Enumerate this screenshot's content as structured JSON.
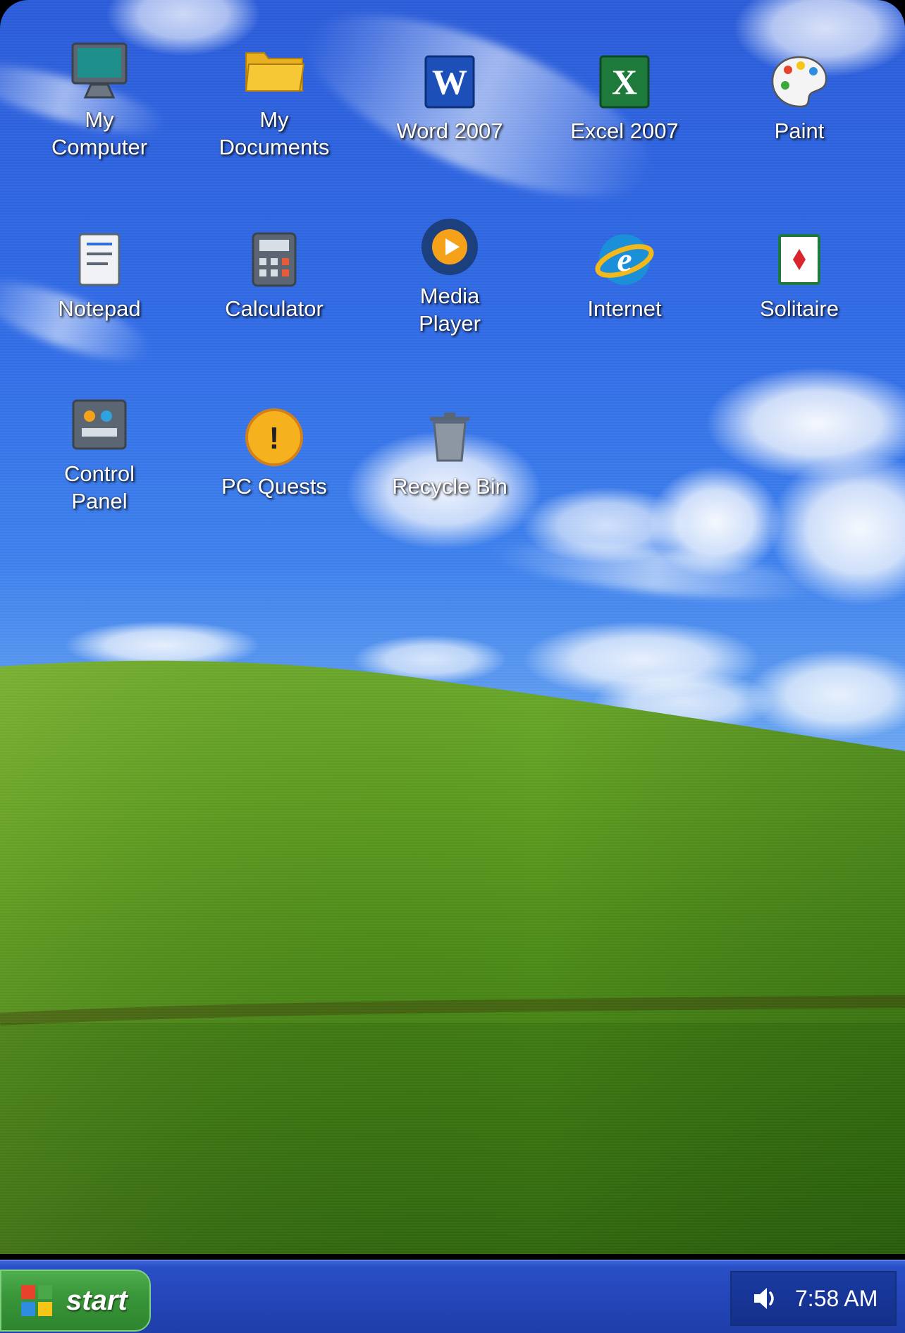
{
  "desktop": {
    "icons": [
      {
        "label": "My\nComputer",
        "icon": "computer-icon"
      },
      {
        "label": "My\nDocuments",
        "icon": "folder-icon"
      },
      {
        "label": "Word 2007",
        "icon": "word-icon"
      },
      {
        "label": "Excel 2007",
        "icon": "excel-icon"
      },
      {
        "label": "Paint",
        "icon": "palette-icon"
      },
      {
        "label": "Notepad",
        "icon": "notepad-icon"
      },
      {
        "label": "Calculator",
        "icon": "calculator-icon"
      },
      {
        "label": "Media\nPlayer",
        "icon": "media-player-icon"
      },
      {
        "label": "Internet",
        "icon": "internet-explorer-icon"
      },
      {
        "label": "Solitaire",
        "icon": "solitaire-card-icon"
      },
      {
        "label": "Control\nPanel",
        "icon": "control-panel-icon"
      },
      {
        "label": "PC Quests",
        "icon": "warning-icon"
      },
      {
        "label": "Recycle Bin",
        "icon": "trash-icon"
      }
    ],
    "word_letter": "W",
    "excel_letter": "X",
    "ie_letter": "e",
    "quest_mark": "!"
  },
  "taskbar": {
    "start_label": "start",
    "clock": "7:58 AM",
    "tray_icon": "volume-icon"
  },
  "colors": {
    "start_green": "#3a973a",
    "taskbar_blue": "#2446b9",
    "logo_red": "#e8412c",
    "logo_green": "#4aa84a",
    "logo_blue": "#2f8de0",
    "logo_yellow": "#f5c518"
  }
}
